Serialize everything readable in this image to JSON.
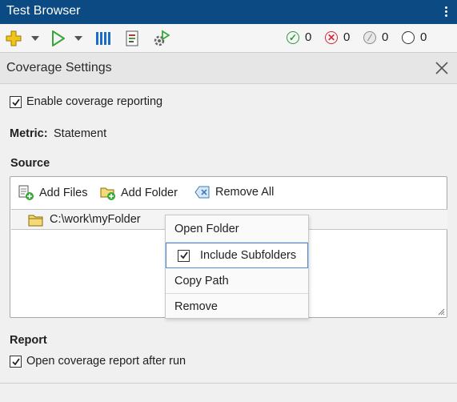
{
  "window": {
    "title": "Test Browser"
  },
  "toolbar": {
    "icons": [
      "add-icon",
      "run-icon",
      "columns-icon",
      "report-icon",
      "settings-run-icon"
    ],
    "status": [
      {
        "icon": "passed-icon",
        "count": "0",
        "color": "#2c9a3a"
      },
      {
        "icon": "failed-icon",
        "count": "0",
        "color": "#d4273a"
      },
      {
        "icon": "filtered-icon",
        "count": "0",
        "color": "#8a8a8a"
      },
      {
        "icon": "not-run-icon",
        "count": "0",
        "color": "#333333"
      }
    ]
  },
  "panel": {
    "title": "Coverage Settings"
  },
  "settings": {
    "enable_coverage_label": "Enable coverage reporting",
    "enable_coverage_checked": true,
    "metric_label": "Metric:",
    "metric_value": "Statement",
    "source_heading": "Source",
    "add_files_label": "Add Files",
    "add_folder_label": "Add Folder",
    "remove_all_label": "Remove All",
    "folders": [
      {
        "path": "C:\\work\\myFolder"
      }
    ],
    "report_heading": "Report",
    "open_report_label": "Open coverage report after run",
    "open_report_checked": true
  },
  "context_menu": {
    "items": [
      {
        "label": "Open Folder"
      },
      {
        "label": "Include Subfolders",
        "checked": true
      },
      {
        "label": "Copy Path"
      },
      {
        "label": "Remove"
      }
    ]
  },
  "colors": {
    "titlebar": "#0b4a82",
    "accent": "#4a8fd0",
    "run_green": "#3aa53a",
    "add_yellow": "#f0c419"
  }
}
